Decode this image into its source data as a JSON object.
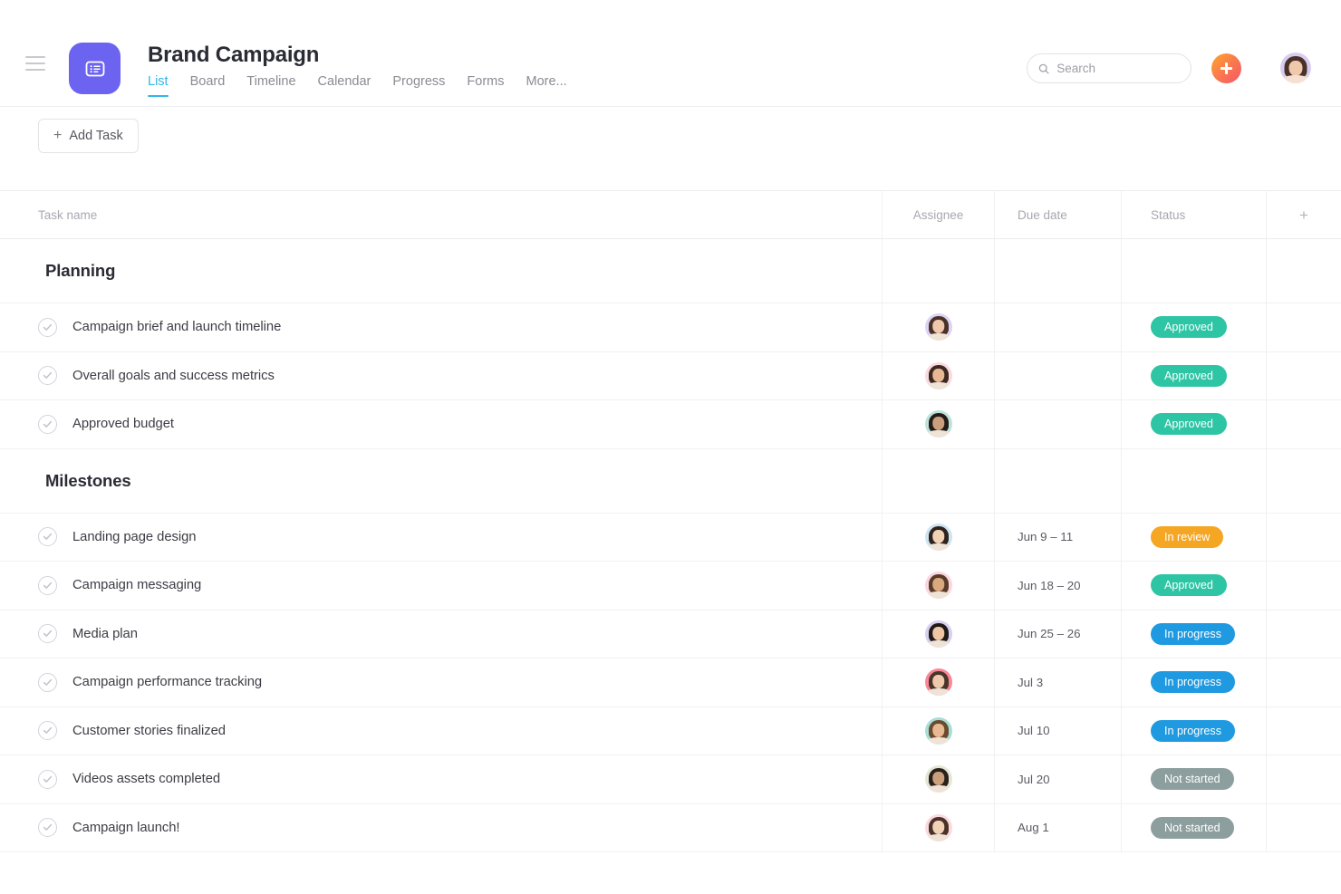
{
  "header": {
    "menu_icon": "hamburger-icon",
    "logo_icon": "list-app-logo-icon",
    "title": "Brand Campaign",
    "tabs": [
      {
        "label": "List",
        "active": true
      },
      {
        "label": "Board",
        "active": false
      },
      {
        "label": "Timeline",
        "active": false
      },
      {
        "label": "Calendar",
        "active": false
      },
      {
        "label": "Progress",
        "active": false
      },
      {
        "label": "Forms",
        "active": false
      },
      {
        "label": "More...",
        "active": false
      }
    ],
    "search": {
      "placeholder": "Search",
      "value": "",
      "icon": "search-icon"
    },
    "add_button_icon": "plus-icon",
    "avatar_icon": "user-avatar"
  },
  "toolbar": {
    "add_task_label": "Add Task",
    "add_task_icon": "plus-icon"
  },
  "table": {
    "columns": {
      "task_name": "Task name",
      "assignee": "Assignee",
      "due_date": "Due date",
      "status": "Status",
      "add_column_icon": "plus-icon"
    },
    "sections": [
      {
        "title": "Planning",
        "tasks": [
          {
            "name": "Campaign brief and launch timeline",
            "assignee_tint": "#ddd3f3",
            "due": "",
            "status": "Approved",
            "status_color": "#2ec5a5"
          },
          {
            "name": "Overall goals and success metrics",
            "assignee_tint": "#fbd9de",
            "due": "",
            "status": "Approved",
            "status_color": "#2ec5a5"
          },
          {
            "name": "Approved budget",
            "assignee_tint": "#bfe3db",
            "due": "",
            "status": "Approved",
            "status_color": "#2ec5a5"
          }
        ]
      },
      {
        "title": "Milestones",
        "tasks": [
          {
            "name": "Landing page design",
            "assignee_tint": "#cfe4f2",
            "due": "Jun 9 – 11",
            "status": "In review",
            "status_color": "#f5a623"
          },
          {
            "name": "Campaign messaging",
            "assignee_tint": "#fbd5e0",
            "due": "Jun 18 – 20",
            "status": "Approved",
            "status_color": "#2ec5a5"
          },
          {
            "name": "Media plan",
            "assignee_tint": "#d8cef0",
            "due": "Jun 25 – 26",
            "status": "In progress",
            "status_color": "#1f9ae0"
          },
          {
            "name": "Campaign performance tracking",
            "assignee_tint": "#fb8697",
            "due": "Jul 3",
            "status": "In progress",
            "status_color": "#1f9ae0"
          },
          {
            "name": "Customer stories finalized",
            "assignee_tint": "#a8ded8",
            "due": "Jul 10",
            "status": "In progress",
            "status_color": "#1f9ae0"
          },
          {
            "name": "Videos assets completed",
            "assignee_tint": "#e3e8d4",
            "due": "Jul 20",
            "status": "Not started",
            "status_color": "#8d9e9e"
          },
          {
            "name": "Campaign launch!",
            "assignee_tint": "#fbd9de",
            "due": "Aug 1",
            "status": "Not started",
            "status_color": "#8d9e9e"
          }
        ]
      }
    ]
  },
  "colors": {
    "brand_purple": "#6c63f0",
    "tab_active_blue": "#31b5ea",
    "status_green": "#2ec5a5",
    "status_orange": "#f5a623",
    "status_blue": "#1f9ae0",
    "status_gray": "#8d9e9e"
  }
}
